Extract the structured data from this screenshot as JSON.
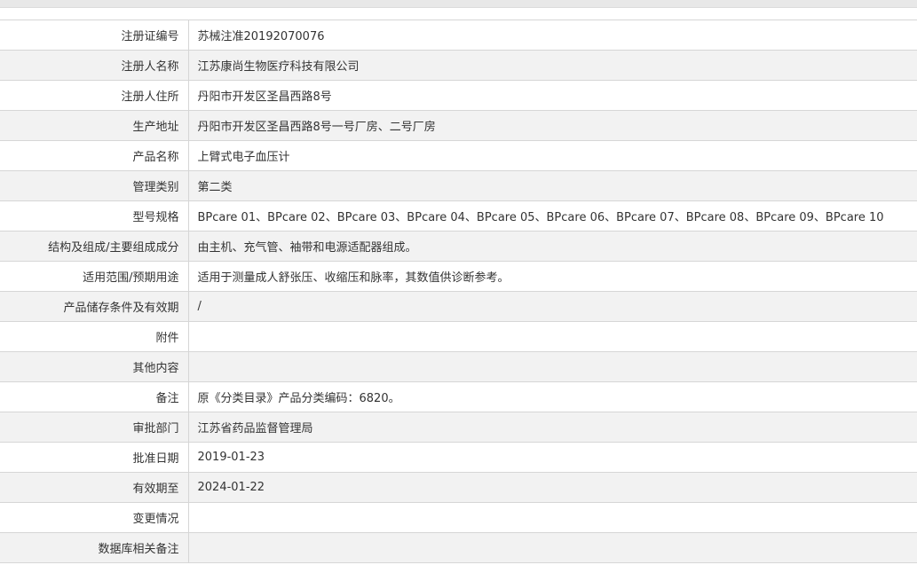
{
  "rows": [
    {
      "label": "注册证编号",
      "value": "苏械注准20192070076"
    },
    {
      "label": "注册人名称",
      "value": "江苏康尚生物医疗科技有限公司"
    },
    {
      "label": "注册人住所",
      "value": "丹阳市开发区圣昌西路8号"
    },
    {
      "label": "生产地址",
      "value": "丹阳市开发区圣昌西路8号一号厂房、二号厂房"
    },
    {
      "label": "产品名称",
      "value": "上臂式电子血压计"
    },
    {
      "label": "管理类别",
      "value": "第二类"
    },
    {
      "label": "型号规格",
      "value": "BPcare 01、BPcare 02、BPcare 03、BPcare 04、BPcare 05、BPcare 06、BPcare 07、BPcare 08、BPcare 09、BPcare 10"
    },
    {
      "label": "结构及组成/主要组成成分",
      "value": "由主机、充气管、袖带和电源适配器组成。"
    },
    {
      "label": "适用范围/预期用途",
      "value": "适用于测量成人舒张压、收缩压和脉率，其数值供诊断参考。"
    },
    {
      "label": "产品储存条件及有效期",
      "value": "/"
    },
    {
      "label": "附件",
      "value": ""
    },
    {
      "label": "其他内容",
      "value": ""
    },
    {
      "label": "备注",
      "value": "原《分类目录》产品分类编码：6820。"
    },
    {
      "label": "审批部门",
      "value": "江苏省药品监督管理局"
    },
    {
      "label": "批准日期",
      "value": "2019-01-23"
    },
    {
      "label": "有效期至",
      "value": "2024-01-22"
    },
    {
      "label": "变更情况",
      "value": ""
    },
    {
      "label": "数据库相关备注",
      "value": ""
    }
  ]
}
